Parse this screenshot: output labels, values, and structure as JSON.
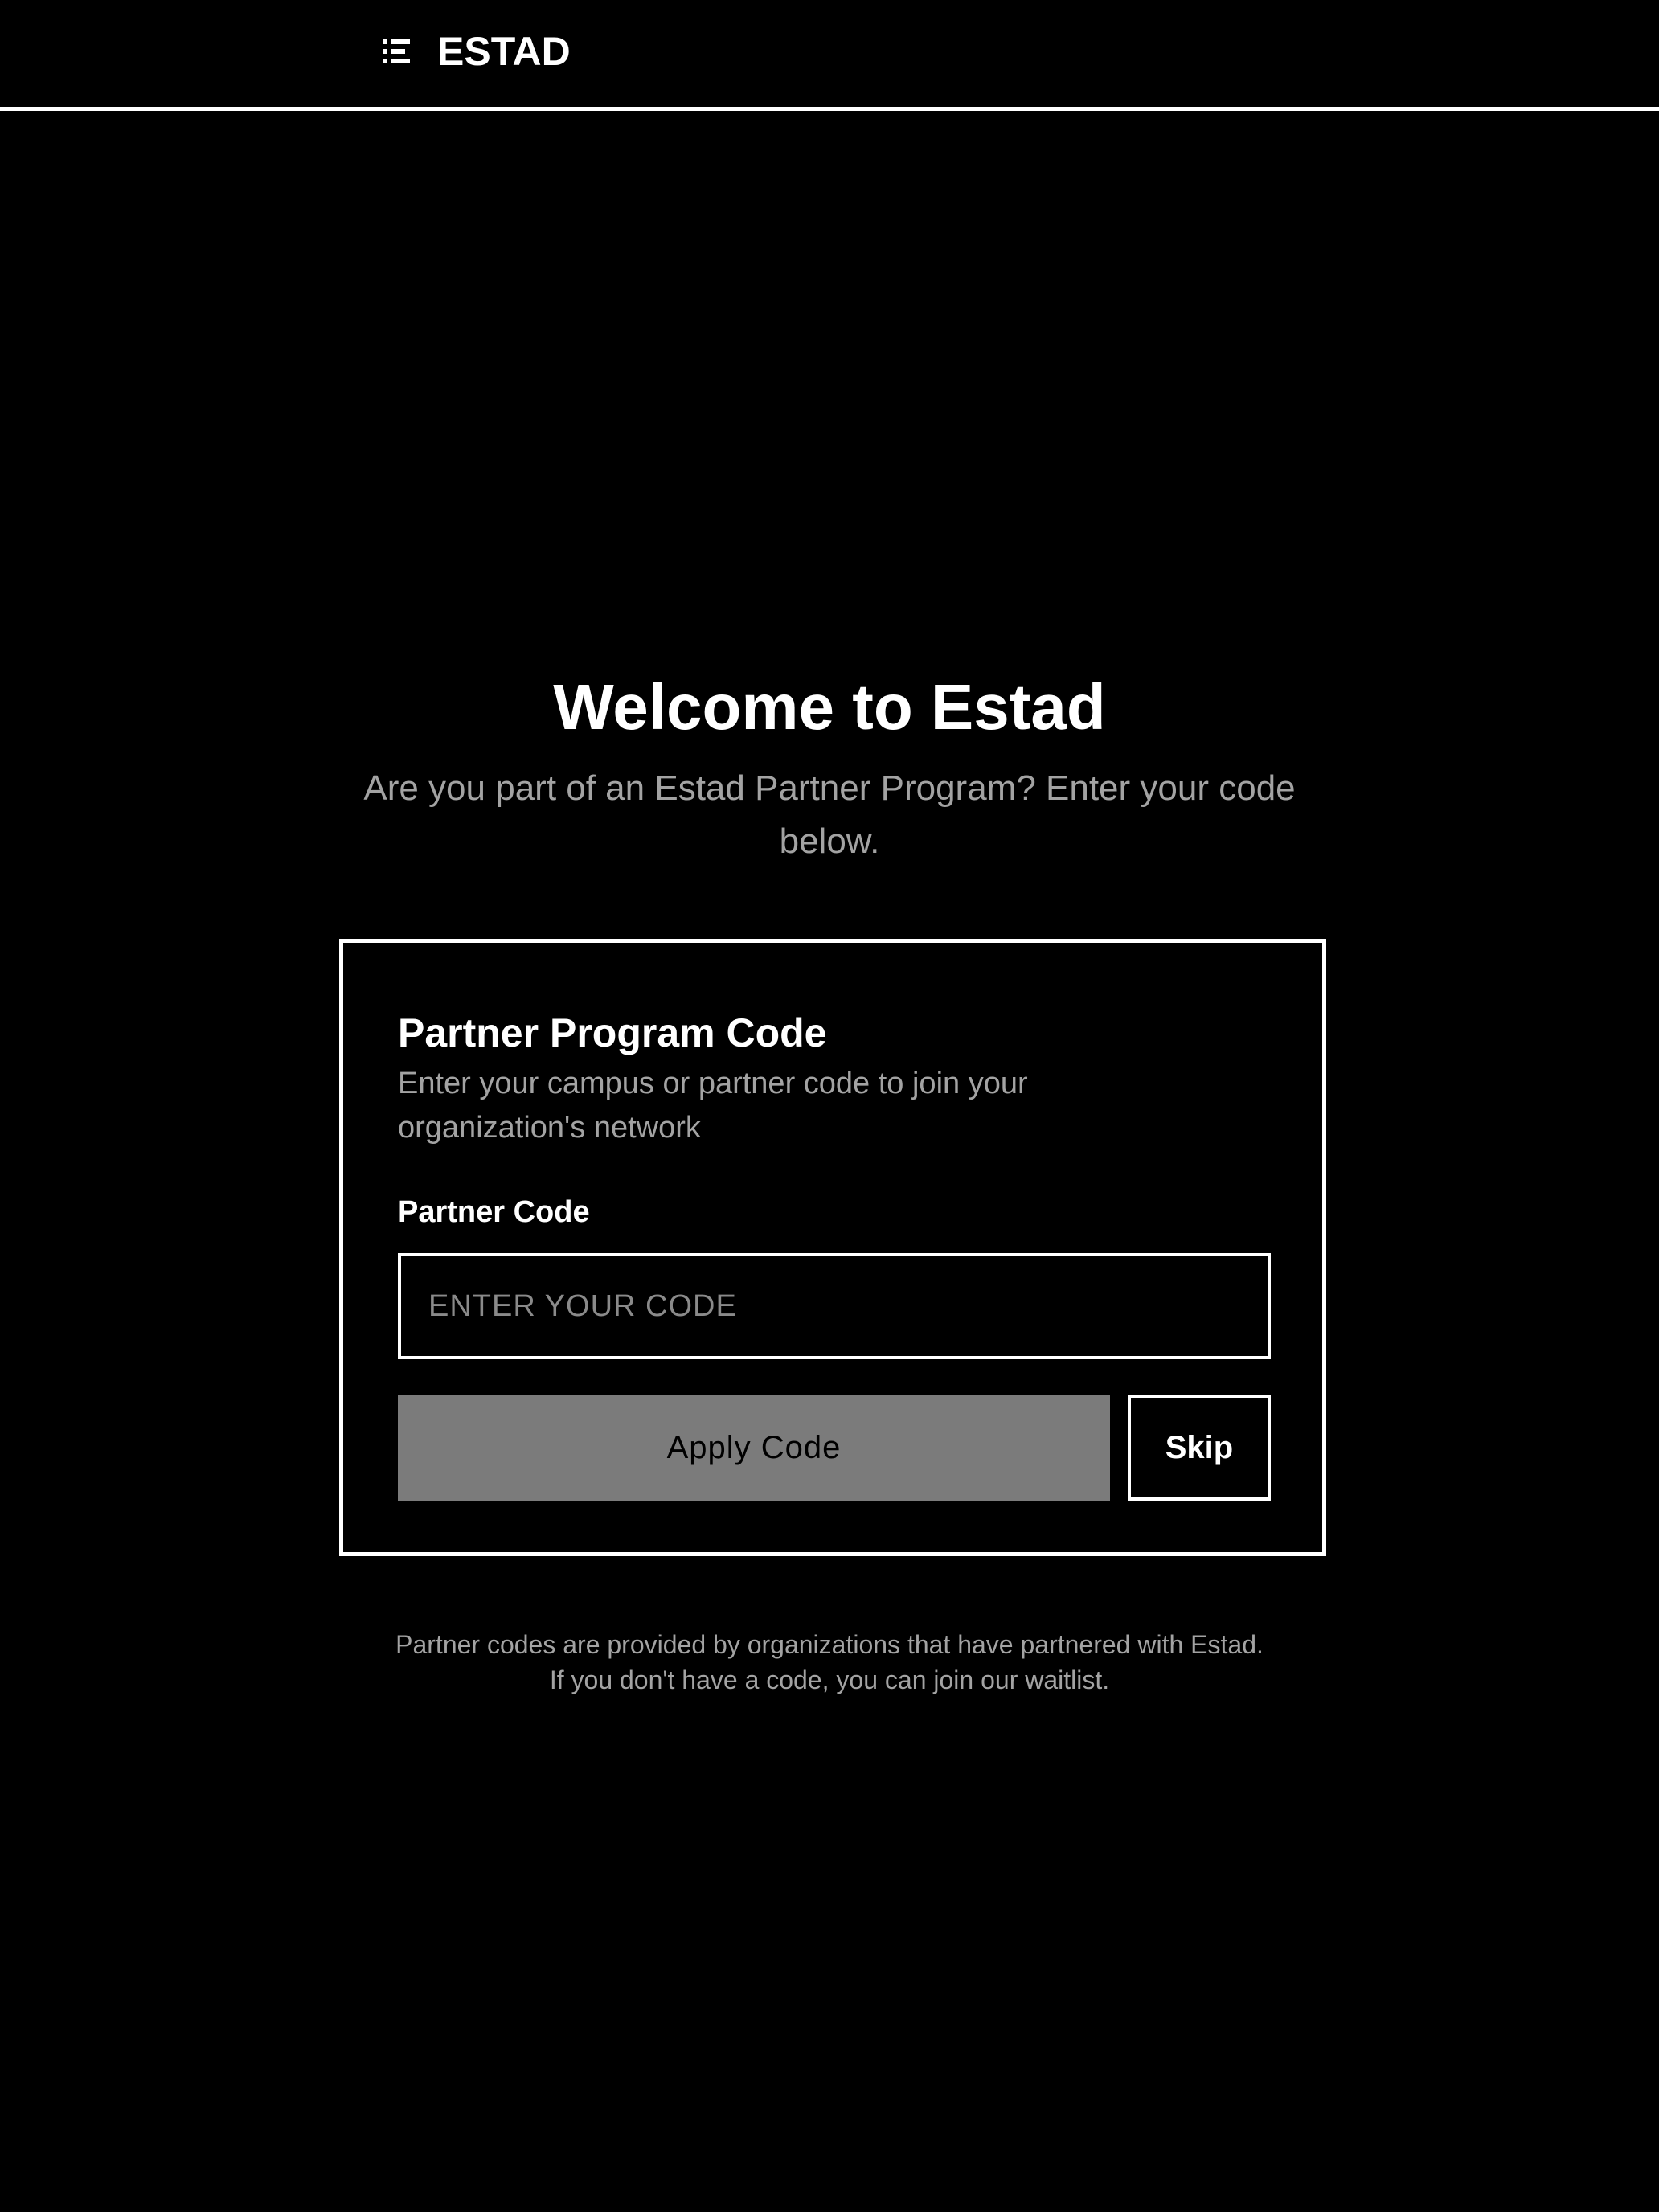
{
  "header": {
    "brand_name": "ESTAD",
    "logo_icon": "estad-logo-icon"
  },
  "hero": {
    "title": "Welcome to Estad",
    "subtitle": "Are you part of an Estad Partner Program? Enter your code below."
  },
  "card": {
    "title": "Partner Program Code",
    "description": "Enter your campus or partner code to join your organization's network",
    "field_label": "Partner Code",
    "input_value": "",
    "input_placeholder": "ENTER YOUR CODE",
    "apply_label": "Apply Code",
    "skip_label": "Skip"
  },
  "footer": {
    "line1": "Partner codes are provided by organizations that have partnered with Estad.",
    "line2": "If you don't have a code, you can join our waitlist."
  },
  "colors": {
    "background": "#000000",
    "text": "#ffffff",
    "muted_text": "#a3a3a3",
    "apply_button_bg": "#7b7b7b"
  }
}
